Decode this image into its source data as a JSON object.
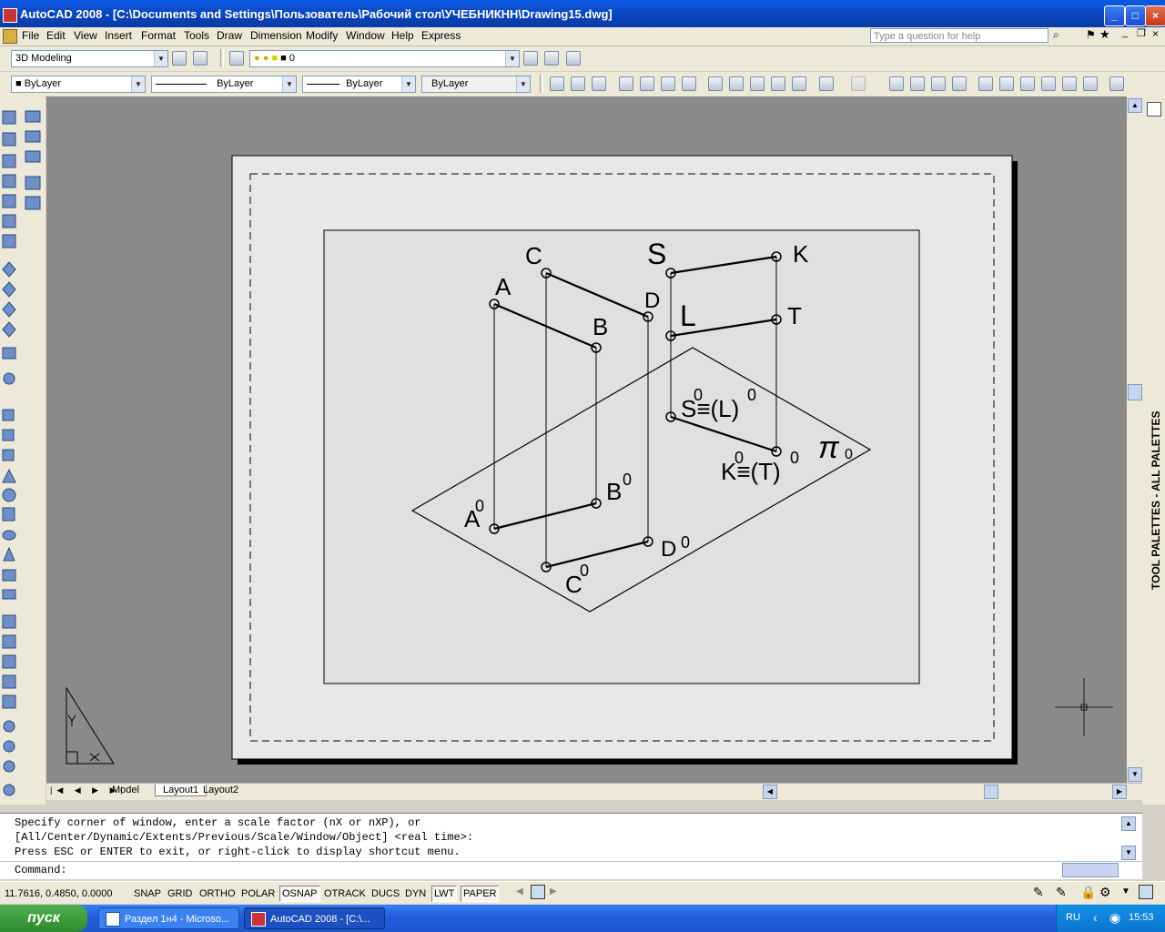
{
  "window": {
    "title": "AutoCAD 2008 - [C:\\Documents and Settings\\Пользователь\\Рабочий стол\\УЧЕБНИКНН\\Drawing15.dwg]"
  },
  "menu": {
    "items": [
      "File",
      "Edit",
      "View",
      "Insert",
      "Format",
      "Tools",
      "Draw",
      "Dimension",
      "Modify",
      "Window",
      "Help",
      "Express"
    ],
    "help_placeholder": "Type a question for help"
  },
  "toolbar": {
    "workspace": "3D Modeling",
    "layer": "0",
    "color": "ByLayer",
    "linetype": "ByLayer",
    "lineweight": "ByLayer",
    "plotstyle": "ByLayer"
  },
  "drawing": {
    "labels": {
      "A": "A",
      "B": "B",
      "C": "C",
      "D": "D",
      "S": "S",
      "K": "K",
      "L": "L",
      "T": "T",
      "A0": "A",
      "B0": "B",
      "C0": "C",
      "D0": "D",
      "SL0": "S≡(L)",
      "KT0": "K≡(T)",
      "zero": "0",
      "pi": "π",
      "pi_sub": "0"
    }
  },
  "tabs": {
    "model": "Model",
    "layout1": "Layout1",
    "layout2": "Layout2"
  },
  "command": {
    "line1": "Specify corner of window, enter a scale factor (nX or nXP), or",
    "line2": "[All/Center/Dynamic/Extents/Previous/Scale/Window/Object] <real time>:",
    "line3": "Press ESC or ENTER to exit, or right-click to display shortcut menu.",
    "prompt": "Command:"
  },
  "status": {
    "coords": "11.7616, 0.4850, 0.0000",
    "buttons": [
      "SNAP",
      "GRID",
      "ORTHO",
      "POLAR",
      "OSNAP",
      "OTRACK",
      "DUCS",
      "DYN",
      "LWT",
      "PAPER"
    ],
    "active": [
      "OSNAP",
      "LWT",
      "PAPER"
    ]
  },
  "right_palette": {
    "title": "TOOL PALETTES - ALL PALETTES"
  },
  "taskbar": {
    "start": "пуск",
    "item1": "Раздел 1н4 - Microso...",
    "item2": "AutoCAD 2008 - [C:\\...",
    "lang": "RU",
    "time": "15:53"
  }
}
